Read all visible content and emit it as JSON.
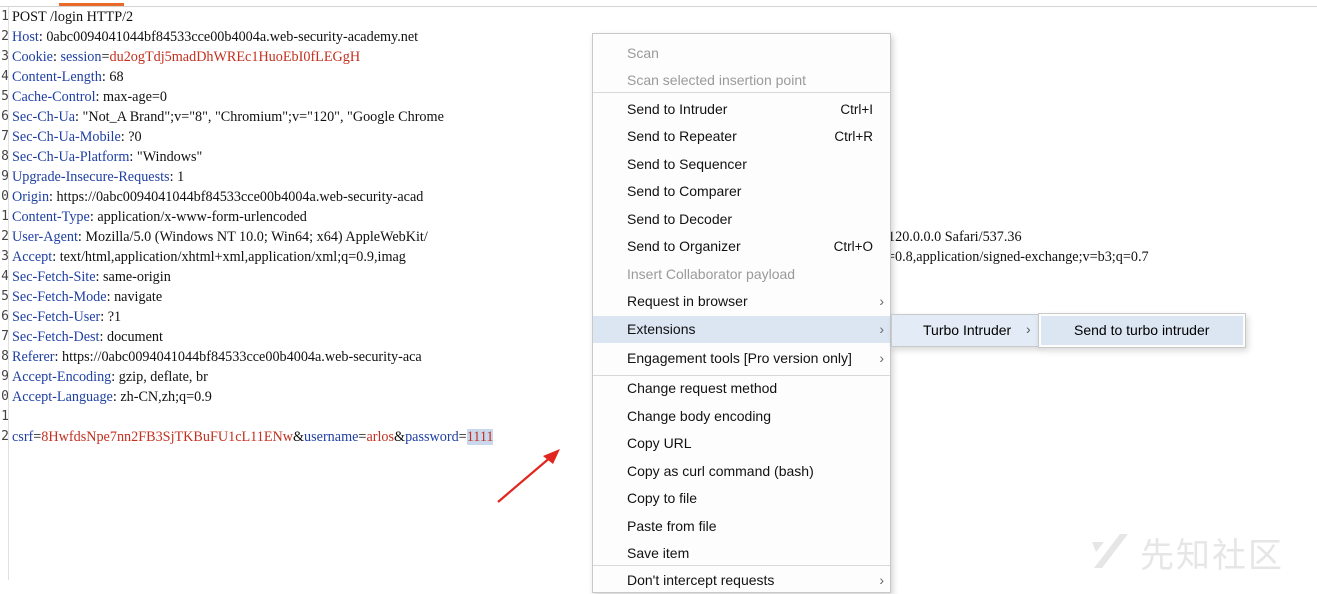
{
  "request": {
    "line_numbers": [
      "1",
      "2",
      "3",
      "4",
      "5",
      "6",
      "7",
      "8",
      "9",
      "0",
      "1",
      "2",
      "3",
      "4",
      "5",
      "6",
      "7",
      "8",
      "9",
      "0",
      "1",
      "2"
    ],
    "lines": [
      {
        "name": "POST /login HTTP/2",
        "value": ""
      },
      {
        "name": "Host",
        "value": "0abc0094041044bf84533cce00b4004a.web-security-academy.net"
      },
      {
        "name": "Cookie",
        "cookie_name": "session",
        "cookie_value": "du2ogTdj5madDhWREc1HuoEbI0fLEGgH"
      },
      {
        "name": "Content-Length",
        "value": "68"
      },
      {
        "name": "Cache-Control",
        "value": "max-age=0"
      },
      {
        "name": "Sec-Ch-Ua",
        "value": "\"Not_A Brand\";v=\"8\", \"Chromium\";v=\"120\", \"Google Chrome"
      },
      {
        "name": "Sec-Ch-Ua-Mobile",
        "value": "?0"
      },
      {
        "name": "Sec-Ch-Ua-Platform",
        "value": "\"Windows\""
      },
      {
        "name": "Upgrade-Insecure-Requests",
        "value": "1"
      },
      {
        "name": "Origin",
        "value": "https://0abc0094041044bf84533cce00b4004a.web-security-acad"
      },
      {
        "name": "Content-Type",
        "value": "application/x-www-form-urlencoded"
      },
      {
        "name": "User-Agent",
        "value": "Mozilla/5.0 (Windows NT 10.0; Win64; x64) AppleWebKit/",
        "tail": "120.0.0.0 Safari/537.36"
      },
      {
        "name": "Accept",
        "value": "text/html,application/xhtml+xml,application/xml;q=0.9,imag",
        "tail": "=0.8,application/signed-exchange;v=b3;q=0.7"
      },
      {
        "name": "Sec-Fetch-Site",
        "value": "same-origin"
      },
      {
        "name": "Sec-Fetch-Mode",
        "value": "navigate"
      },
      {
        "name": "Sec-Fetch-User",
        "value": "?1"
      },
      {
        "name": "Sec-Fetch-Dest",
        "value": "document"
      },
      {
        "name": "Referer",
        "value": "https://0abc0094041044bf84533cce00b4004a.web-security-aca"
      },
      {
        "name": "Accept-Encoding",
        "value": "gzip, deflate, br"
      },
      {
        "name": "Accept-Language",
        "value": "zh-CN,zh;q=0.9"
      }
    ],
    "body": {
      "csrf_key": "csrf",
      "csrf_value": "8HwfdsNpe7nn2FB3SjTKBuFU1cL11ENw",
      "user_key": "username",
      "user_value": "arlos",
      "pass_key": "password",
      "pass_value": "1111"
    }
  },
  "context_menu": {
    "items": [
      {
        "label": "Scan",
        "disabled": true
      },
      {
        "label": "Scan selected insertion point",
        "disabled": true
      },
      {
        "separator": true
      },
      {
        "label": "Send to Intruder",
        "shortcut": "Ctrl+I"
      },
      {
        "label": "Send to Repeater",
        "shortcut": "Ctrl+R"
      },
      {
        "label": "Send to Sequencer"
      },
      {
        "label": "Send to Comparer"
      },
      {
        "label": "Send to Decoder"
      },
      {
        "label": "Send to Organizer",
        "shortcut": "Ctrl+O"
      },
      {
        "label": "Insert Collaborator payload",
        "disabled": true
      },
      {
        "label": "Request in browser",
        "submenu": true
      },
      {
        "label": "Extensions",
        "submenu": true,
        "hover": true
      },
      {
        "label": "Engagement tools [Pro version only]",
        "submenu": true
      },
      {
        "separator": true
      },
      {
        "label": "Change request method"
      },
      {
        "label": "Change body encoding"
      },
      {
        "label": "Copy URL"
      },
      {
        "label": "Copy as curl command (bash)"
      },
      {
        "label": "Copy to file"
      },
      {
        "label": "Paste from file"
      },
      {
        "label": "Save item"
      },
      {
        "separator": true
      },
      {
        "label": "Don't intercept requests",
        "submenu": true
      }
    ]
  },
  "extensions_submenu": {
    "label": "Turbo Intruder"
  },
  "turbo_submenu": {
    "label": "Send to turbo intruder"
  },
  "watermark": {
    "text": "先知社区"
  },
  "colors": {
    "header_name": "#1f3fa3",
    "value_red": "#c3301f",
    "menu_hover": "#dce6f3",
    "arrow": "#e0261f"
  }
}
